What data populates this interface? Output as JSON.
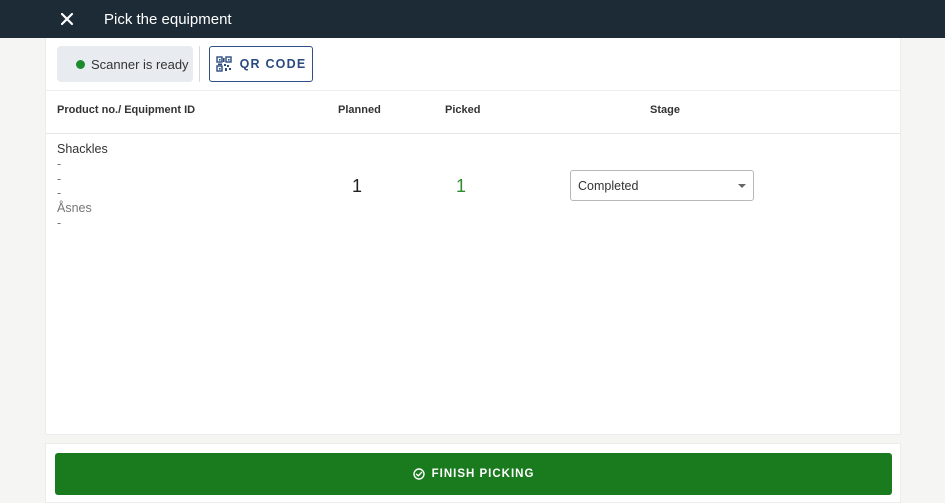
{
  "header": {
    "title": "Pick the equipment",
    "close_icon": "close-icon"
  },
  "toolbar": {
    "scanner_status": "Scanner is ready",
    "scanner_status_color": "#1e8a2e",
    "qr_button_label": "QR CODE",
    "qr_icon": "qr-code-icon"
  },
  "table": {
    "columns": [
      "Product no./ Equipment ID",
      "Planned",
      "Picked",
      "Stage"
    ],
    "rows": [
      {
        "product_lines": [
          "Shackles",
          "-",
          "-",
          "-",
          "Åsnes",
          "-"
        ],
        "planned": "1",
        "picked": "1",
        "stage": "Completed"
      }
    ]
  },
  "footer": {
    "finish_label": "FINISH PICKING",
    "finish_icon": "check-circle-icon",
    "finish_color": "#1a7a1e"
  },
  "colors": {
    "header_bg": "#1c2b36",
    "qr_accent": "#2b4a7d",
    "picked_green": "#2e8b2e"
  }
}
